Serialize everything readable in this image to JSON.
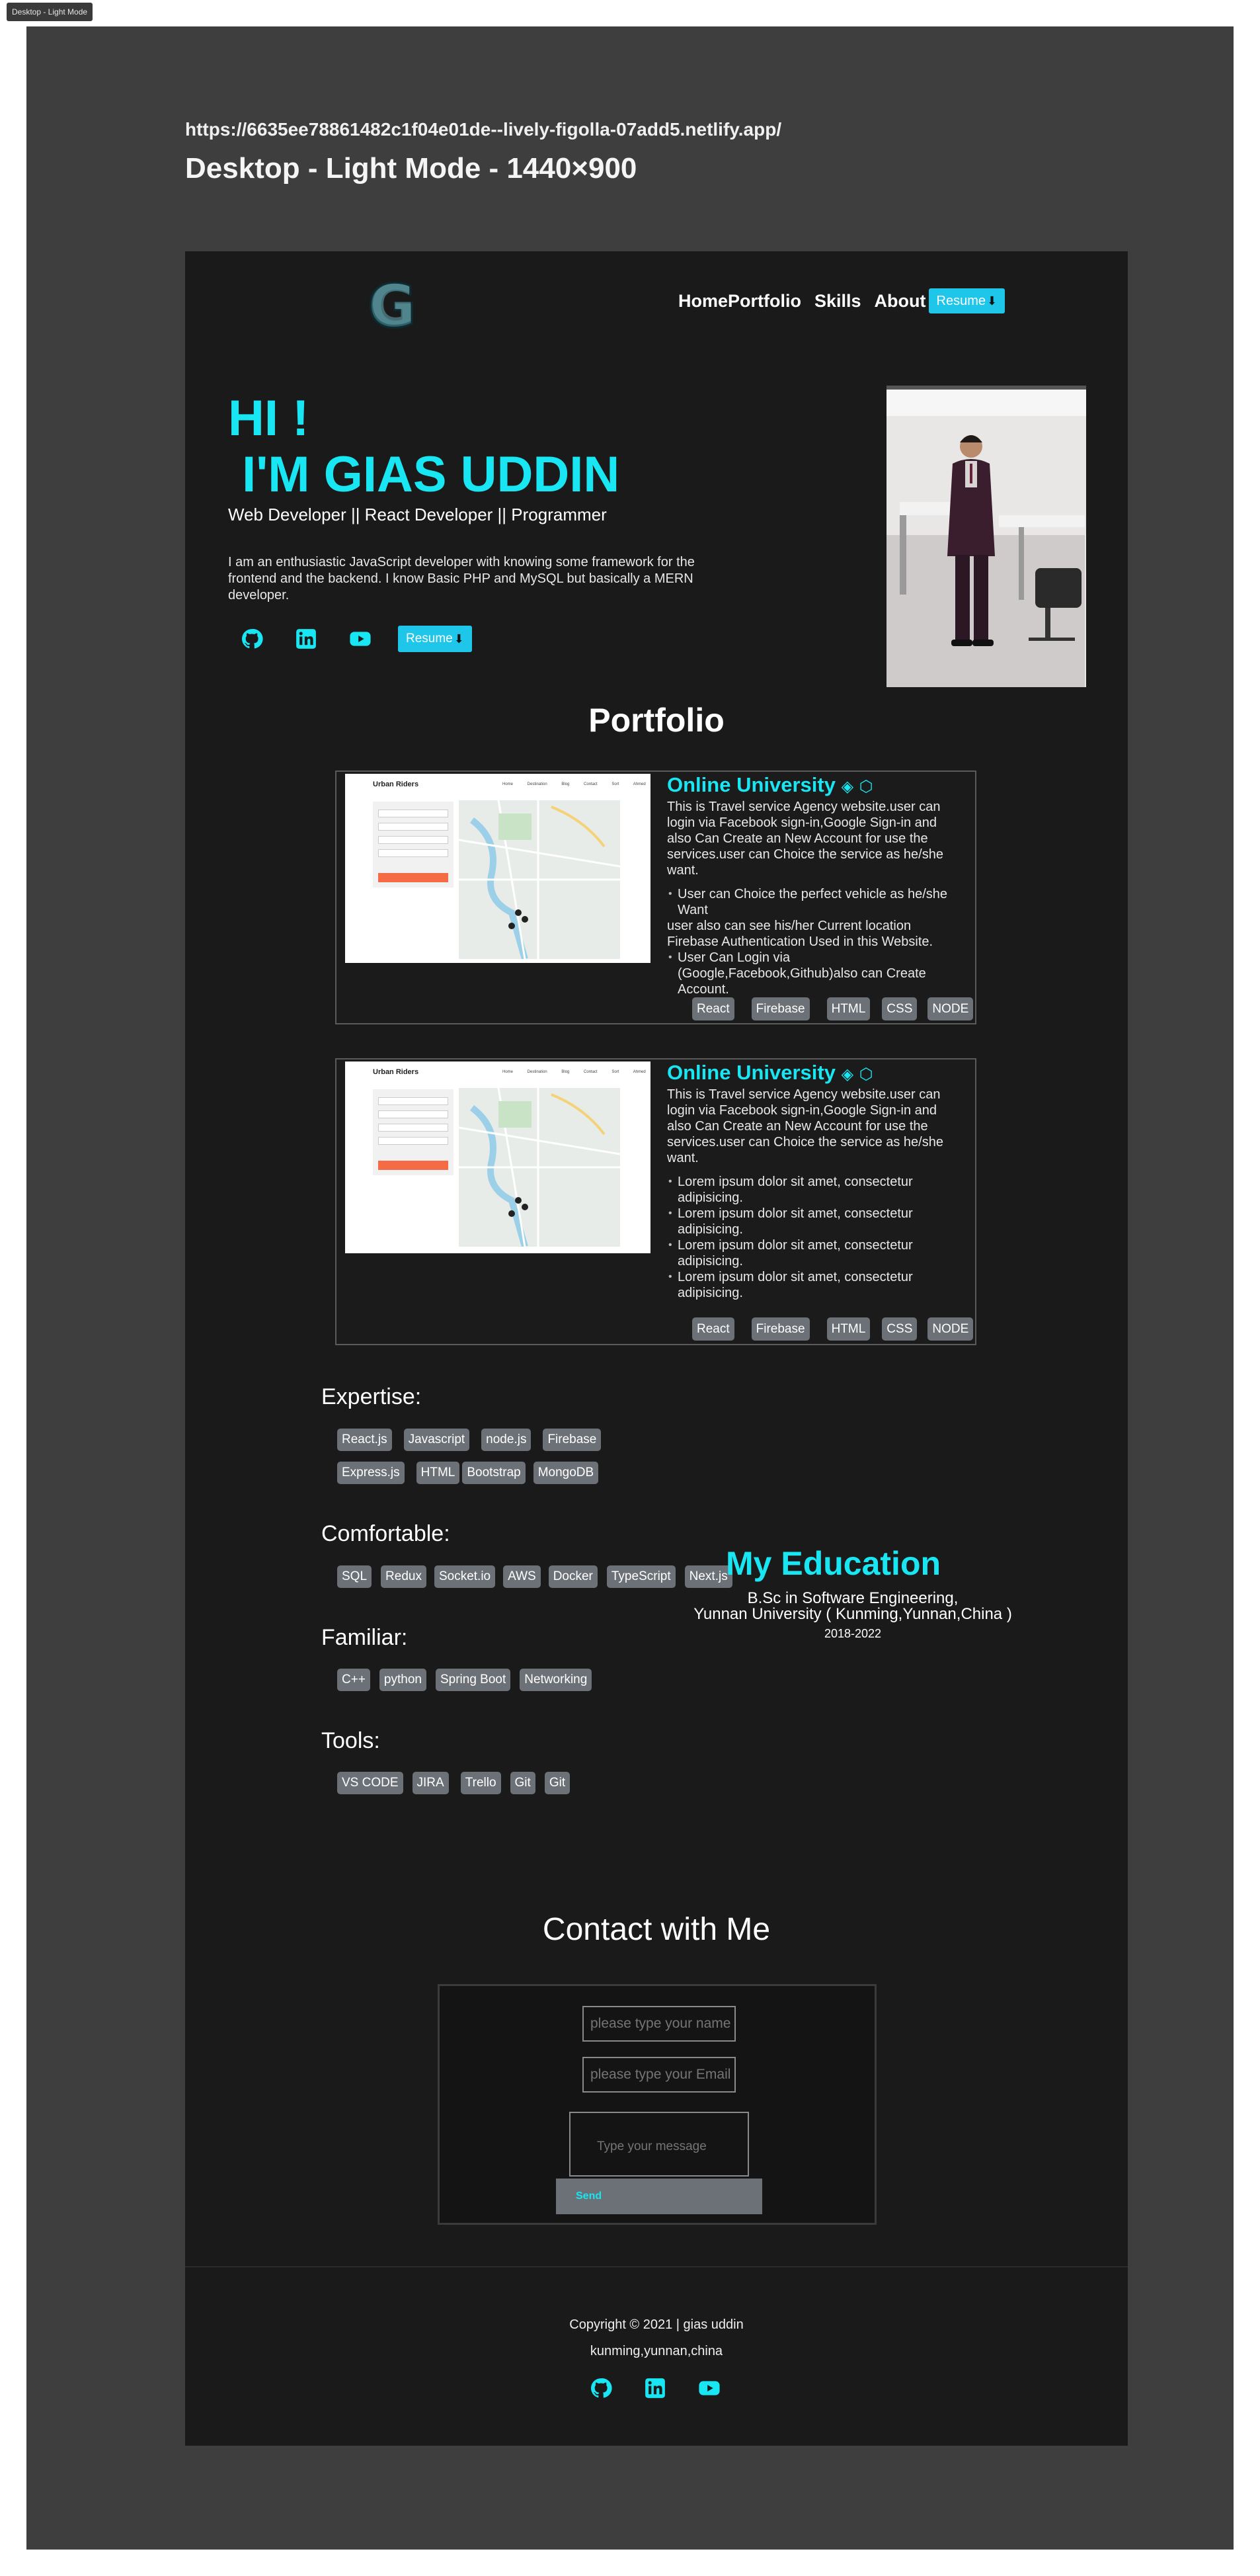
{
  "frame_tag": "Desktop - Light Mode",
  "url": "https://6635ee78861482c1f04e01de--lively-figolla-07add5.netlify.app/",
  "frame_title": "Desktop - Light Mode - 1440×900",
  "colors": {
    "accent": "#18e6f2",
    "button": "#1ec6ea",
    "background": "#1a1a1a",
    "tag": "#6c7077"
  },
  "nav": {
    "logo": "G",
    "home": "Home",
    "portfolio": "Portfolio",
    "skills": "Skills",
    "about": "About",
    "resume": "Resume"
  },
  "hero": {
    "greeting": "HI !",
    "name": " I'M GIAS UDDIN",
    "roles": "Web Developer || React Developer || Programmer",
    "bio": "I am an enthusiastic JavaScript developer with knowing some framework for the frontend and the backend. I know Basic PHP and MySQL but basically a MERN developer.",
    "social_icons": [
      "github-icon",
      "linkedin-icon",
      "youtube-icon"
    ],
    "resume": "Resume"
  },
  "portfolio": {
    "title": "Portfolio",
    "projects": [
      {
        "title": "Online University",
        "screenshot_brand": "Urban Riders",
        "screenshot_nav": "Home Destination Blog Contact Sort Ahmed",
        "description": "This is Travel service Agency website.user can login via Facebook sign-in,Google Sign-in and also Can Create an New Account for use the services.user can Choice the service as he/she want.",
        "bullet1": "User can Choice the perfect vehicle as he/she Want",
        "line1": "user also can see his/her Current location",
        "line2": "Firebase Authentication Used in this Website.",
        "bullet2": "User Can Login via (Google,Facebook,Github)also can Create Account.",
        "tags": [
          "React",
          "Firebase",
          "HTML",
          "CSS",
          "NODE"
        ]
      },
      {
        "title": "Online University",
        "screenshot_brand": "Urban Riders",
        "screenshot_nav": "Home Destination Blog Contact Sort Ahmed",
        "description": "This is Travel service Agency website.user can login via Facebook sign-in,Google Sign-in and also Can Create an New Account for use the services.user can Choice the service as he/she want.",
        "bullets": [
          "Lorem ipsum dolor sit amet, consectetur adipisicing.",
          "Lorem ipsum dolor sit amet, consectetur adipisicing.",
          "Lorem ipsum dolor sit amet, consectetur adipisicing.",
          "Lorem ipsum dolor sit amet, consectetur adipisicing."
        ],
        "tags": [
          "React",
          "Firebase",
          "HTML",
          "CSS",
          "NODE"
        ]
      }
    ]
  },
  "skills": {
    "expertise": {
      "heading": "Expertise:",
      "row1": [
        "React.js",
        "Javascript",
        "node.js",
        "Firebase"
      ],
      "row2": [
        "Express.js",
        "HTML",
        "Bootstrap",
        "MongoDB"
      ]
    },
    "comfortable": {
      "heading": "Comfortable:",
      "items": [
        "SQL",
        "Redux",
        "Socket.io",
        "AWS",
        "Docker",
        "TypeScript",
        "Next.js"
      ]
    },
    "familiar": {
      "heading": "Familiar:",
      "items": [
        "C++",
        "python",
        "Spring Boot",
        "Networking"
      ]
    },
    "tools": {
      "heading": "Tools:",
      "items": [
        "VS CODE",
        "JIRA",
        "Trello",
        "Git",
        "Git"
      ]
    }
  },
  "education": {
    "title": "My Education",
    "degree": "B.Sc in Software Engineering,",
    "school": "Yunnan University ( Kunming,Yunnan,China )",
    "years": "2018-2022"
  },
  "contact": {
    "title": "Contact with Me",
    "name_placeholder": "please type your name",
    "email_placeholder": "please type your Email",
    "message_placeholder": "Type your message",
    "send": "Send"
  },
  "footer": {
    "copyright": "Copyright © 2021 | gias uddin",
    "location": "kunming,yunnan,china",
    "social_icons": [
      "github-icon",
      "linkedin-icon",
      "youtube-icon"
    ]
  }
}
